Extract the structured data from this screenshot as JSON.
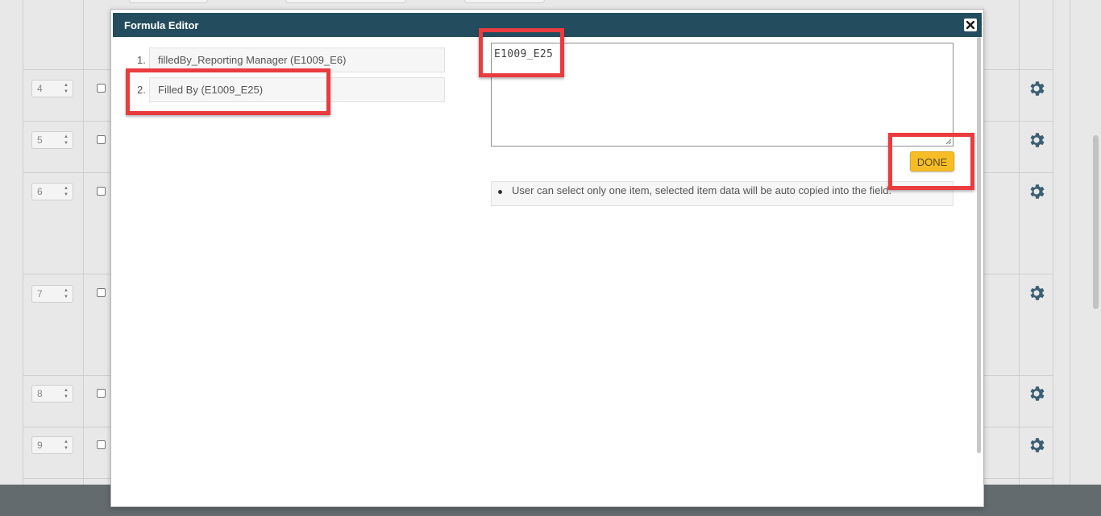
{
  "modal": {
    "title": "Formula Editor"
  },
  "field_list": [
    {
      "index": "1.",
      "label": "filledBy_Reporting Manager (E1009_E6)"
    },
    {
      "index": "2.",
      "label": "Filled By (E1009_E25)"
    }
  ],
  "formula": {
    "value": "E1009_E25"
  },
  "done_button": {
    "label": "DONE"
  },
  "info": {
    "text": "User can select only one item, selected item data will be auto copied into the field."
  },
  "background_rows": [
    {
      "number": "4"
    },
    {
      "number": "5"
    },
    {
      "number": "6"
    },
    {
      "number": "7"
    },
    {
      "number": "8"
    },
    {
      "number": "9"
    }
  ],
  "colors": {
    "header": "#244c5f",
    "done_button": "#f7bd26",
    "highlight": "#ea3b3f",
    "gear": "#3a6072",
    "footer": "#636b6e"
  },
  "icons": {
    "close": "close-icon",
    "settings": "gear-icon"
  }
}
